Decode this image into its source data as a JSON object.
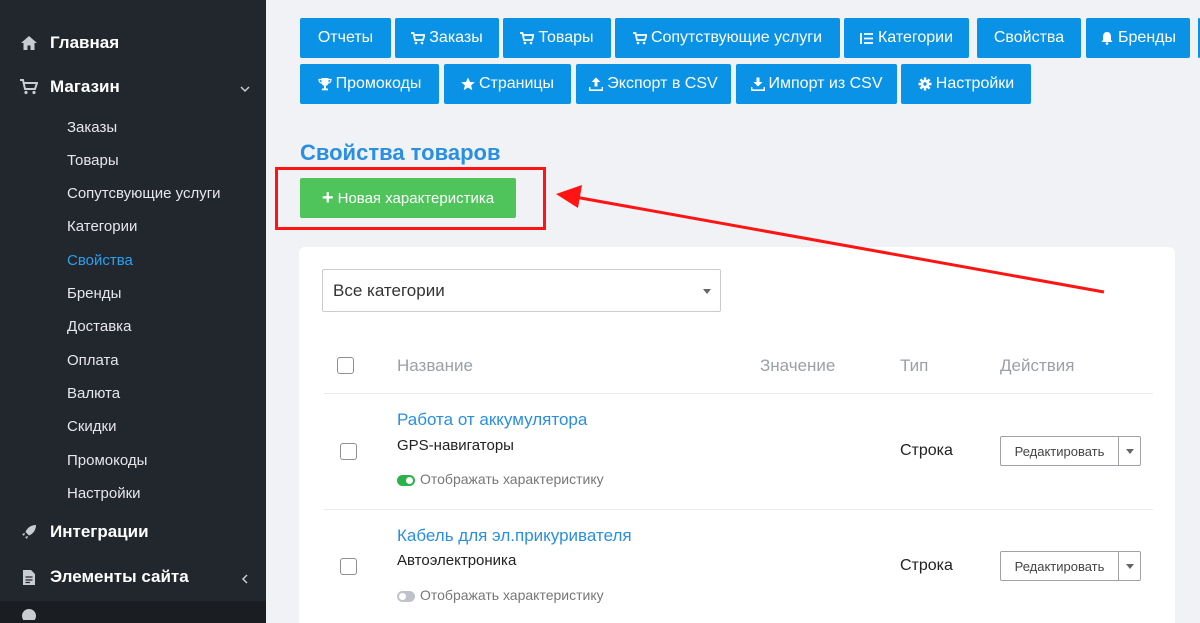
{
  "sidebar": {
    "main_items": [
      {
        "label": "Главная",
        "icon": "home-icon"
      },
      {
        "label": "Магазин",
        "icon": "cart-icon"
      },
      {
        "label": "Интеграции",
        "icon": "rocket-icon"
      },
      {
        "label": "Элементы сайта",
        "icon": "file-icon"
      }
    ],
    "sub_items": [
      "Заказы",
      "Товары",
      "Сопутсвующие услуги",
      "Категории",
      "Свойства",
      "Бренды",
      "Доставка",
      "Оплата",
      "Валюта",
      "Скидки",
      "Промокоды",
      "Настройки"
    ],
    "active_sub": "Свойства"
  },
  "toolbar": {
    "buttons": [
      {
        "label": "Отчеты",
        "icon": ""
      },
      {
        "label": "Заказы",
        "icon": "cart-icon"
      },
      {
        "label": "Товары",
        "icon": "cart-icon"
      },
      {
        "label": "Сопутствующие услуги",
        "icon": "cart-plus-icon"
      },
      {
        "label": "Категории",
        "icon": "list-icon"
      },
      {
        "label": "Свойства",
        "icon": ""
      },
      {
        "label": "Бренды",
        "icon": "bell-icon"
      },
      {
        "label": "Промокоды",
        "icon": "trophy-icon"
      },
      {
        "label": "Страницы",
        "icon": "star-icon"
      },
      {
        "label": "Экспорт в CSV",
        "icon": "upload-icon"
      },
      {
        "label": "Импорт из CSV",
        "icon": "download-icon"
      },
      {
        "label": "Настройки",
        "icon": "gear-icon"
      }
    ]
  },
  "main": {
    "title": "Свойства товаров",
    "new_button": "Новая характеристика",
    "filter": {
      "value": "Все категории"
    },
    "columns": [
      "Название",
      "Значение",
      "Тип",
      "Действия"
    ],
    "rows": [
      {
        "name": "Работа от аккумулятора",
        "category": "GPS-навигаторы",
        "toggle_label": "Отображать характеристику",
        "visible": true,
        "type": "Строка",
        "action": "Редактировать"
      },
      {
        "name": "Кабель для эл.прикуривателя",
        "category": "Автоэлектроника",
        "toggle_label": "Отображать характеристику",
        "visible": false,
        "type": "Строка",
        "action": "Редактировать"
      }
    ]
  },
  "colors": {
    "accent": "#0a92e6",
    "success": "#4ec45a",
    "annotation": "#ff1414",
    "sidebar": "#22262d"
  }
}
